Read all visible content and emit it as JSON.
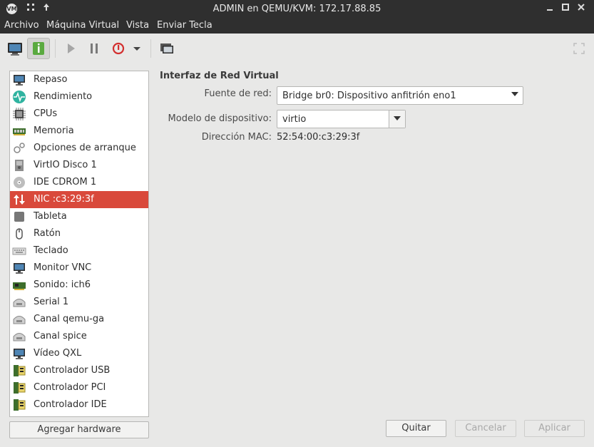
{
  "window": {
    "title": "ADMIN en QEMU/KVM: 172.17.88.85",
    "app_icon_text": "VM"
  },
  "menu": {
    "items": [
      "Archivo",
      "Máquina Virtual",
      "Vista",
      "Enviar Tecla"
    ]
  },
  "toolbar": {
    "tools": [
      "console-icon",
      "details-icon",
      "run-icon",
      "pause-icon",
      "shutdown-icon",
      "shutdown-menu-icon",
      "snapshots-icon",
      "fullscreen-icon"
    ]
  },
  "sidebar": {
    "items": [
      {
        "label": "Repaso",
        "icon": "monitor-icon"
      },
      {
        "label": "Rendimiento",
        "icon": "performance-icon"
      },
      {
        "label": "CPUs",
        "icon": "cpu-icon"
      },
      {
        "label": "Memoria",
        "icon": "memory-icon"
      },
      {
        "label": "Opciones de arranque",
        "icon": "boot-options-icon"
      },
      {
        "label": "VirtIO Disco 1",
        "icon": "disk-icon"
      },
      {
        "label": "IDE CDROM 1",
        "icon": "cdrom-icon"
      },
      {
        "label": "NIC :c3:29:3f",
        "icon": "nic-icon",
        "selected": true
      },
      {
        "label": "Tableta",
        "icon": "tablet-icon"
      },
      {
        "label": "Ratón",
        "icon": "mouse-icon"
      },
      {
        "label": "Teclado",
        "icon": "keyboard-icon"
      },
      {
        "label": "Monitor VNC",
        "icon": "monitor-icon"
      },
      {
        "label": "Sonido: ich6",
        "icon": "sound-card-icon"
      },
      {
        "label": "Serial 1",
        "icon": "serial-icon"
      },
      {
        "label": "Canal qemu-ga",
        "icon": "channel-icon"
      },
      {
        "label": "Canal spice",
        "icon": "channel-icon"
      },
      {
        "label": "Vídeo QXL",
        "icon": "monitor-icon"
      },
      {
        "label": "Controlador USB",
        "icon": "controller-icon"
      },
      {
        "label": "Controlador PCI",
        "icon": "controller-icon"
      },
      {
        "label": "Controlador IDE",
        "icon": "controller-icon"
      }
    ],
    "add_hardware_label": "Agregar hardware"
  },
  "details": {
    "section_title": "Interfaz de Red Virtual",
    "source_label": "Fuente de red:",
    "source_value": "Bridge br0: Dispositivo anfitrión eno1",
    "model_label": "Modelo de dispositivo:",
    "model_value": "virtio",
    "mac_label": "Dirección MAC:",
    "mac_value": "52:54:00:c3:29:3f"
  },
  "buttons": {
    "quit": "Quitar",
    "cancel": "Cancelar",
    "apply": "Aplicar"
  },
  "colors": {
    "selection": "#d9493b",
    "titlebar": "#2f2f2f",
    "window_bg": "#e8e8e7"
  }
}
